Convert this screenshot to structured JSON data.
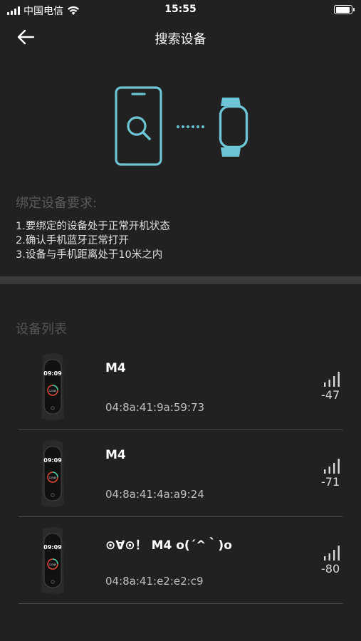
{
  "status_bar": {
    "carrier": "中国电信",
    "time": "15:55"
  },
  "nav": {
    "title": "搜索设备"
  },
  "requirements": {
    "title": "绑定设备要求:",
    "items": [
      "1.要绑定的设备处于正常开机状态",
      "2.确认手机蓝牙正常打开",
      "3.设备与手机距离处于10米之内"
    ]
  },
  "device_list": {
    "title": "设备列表",
    "devices": [
      {
        "name": "M4",
        "mac": "04:8a:41:9a:59:73",
        "rssi": "-47",
        "watch_time": "09:09",
        "watch_steps": "12345"
      },
      {
        "name": "M4",
        "mac": "04:8a:41:4a:a9:24",
        "rssi": "-71",
        "watch_time": "09:09",
        "watch_steps": "12345"
      },
      {
        "name": "⊙∀⊙！ M4 o(´^｀)o",
        "mac": "04:8a:41:e2:e2:c9",
        "rssi": "-80",
        "watch_time": "09:09",
        "watch_steps": "12345"
      }
    ]
  },
  "colors": {
    "background": "#212121",
    "accent": "#6cc4d4",
    "divider_band": "#3a3a3a"
  },
  "icons": {
    "back": "back-arrow-icon",
    "hero_phone": "phone-search-icon",
    "hero_band": "band-icon",
    "signal": "signal-strength-icon"
  }
}
